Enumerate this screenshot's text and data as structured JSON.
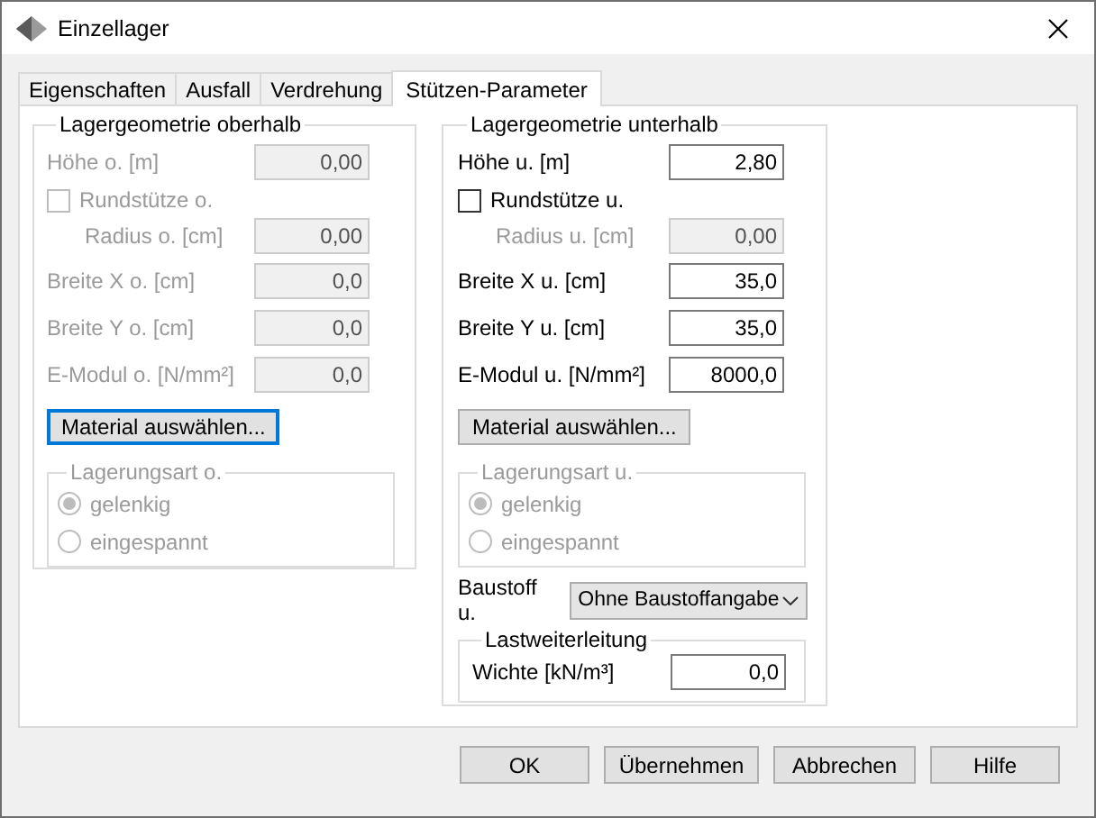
{
  "window": {
    "title": "Einzellager"
  },
  "tabs": [
    {
      "label": "Eigenschaften",
      "selected": false
    },
    {
      "label": "Ausfall",
      "selected": false
    },
    {
      "label": "Verdrehung",
      "selected": false
    },
    {
      "label": "Stützen-Parameter",
      "selected": true
    }
  ],
  "upper_group": {
    "title": "Lagergeometrie oberhalb",
    "rows": [
      {
        "kind": "number",
        "label": "Höhe o. [m]",
        "value": "0,00",
        "disabled": true
      },
      {
        "kind": "checkbox",
        "label": "Rundstütze o.",
        "checked": false,
        "disabled": true
      },
      {
        "kind": "dependent_number",
        "label": "Radius o. [cm]",
        "value": "0,00",
        "disabled": true
      },
      {
        "kind": "number",
        "label": "Breite X o. [cm]",
        "value": "0,0",
        "disabled": true
      },
      {
        "kind": "number",
        "label": "Breite Y o. [cm]",
        "value": "0,0",
        "disabled": true
      },
      {
        "kind": "number",
        "label": "E-Modul o. [N/mm²]",
        "value": "0,0",
        "disabled": true
      }
    ],
    "material_button": {
      "label": "Material auswählen...",
      "focused": true
    },
    "support_type": {
      "title": "Lagerungsart o.",
      "disabled": true,
      "options": [
        {
          "label": "gelenkig",
          "selected": true
        },
        {
          "label": "eingespannt",
          "selected": false
        }
      ]
    }
  },
  "lower_group": {
    "title": "Lagergeometrie unterhalb",
    "rows": [
      {
        "kind": "number",
        "label": "Höhe u. [m]",
        "value": "2,80",
        "disabled": false
      },
      {
        "kind": "checkbox",
        "label": "Rundstütze u.",
        "checked": false,
        "disabled": false
      },
      {
        "kind": "dependent_number",
        "label": "Radius u. [cm]",
        "value": "0,00",
        "disabled": true
      },
      {
        "kind": "number",
        "label": "Breite X u. [cm]",
        "value": "35,0",
        "disabled": false
      },
      {
        "kind": "number",
        "label": "Breite Y u. [cm]",
        "value": "35,0",
        "disabled": false
      },
      {
        "kind": "number",
        "label": "E-Modul u. [N/mm²]",
        "value": "8000,0",
        "disabled": false
      }
    ],
    "material_button": {
      "label": "Material auswählen...",
      "focused": false
    },
    "support_type": {
      "title": "Lagerungsart u.",
      "disabled": true,
      "options": [
        {
          "label": "gelenkig",
          "selected": true
        },
        {
          "label": "eingespannt",
          "selected": false
        }
      ]
    },
    "material": {
      "label": "Baustoff u.",
      "value": "Ohne Baustoffangabe"
    },
    "load_transfer": {
      "title": "Lastweiterleitung",
      "label": "Wichte [kN/m³]",
      "value": "0,0"
    }
  },
  "buttons": [
    {
      "label": "OK"
    },
    {
      "label": "Übernehmen"
    },
    {
      "label": "Abbrechen"
    },
    {
      "label": "Hilfe"
    }
  ]
}
